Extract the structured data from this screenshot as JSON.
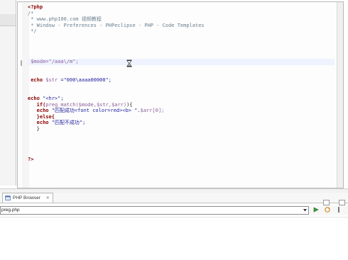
{
  "editor": {
    "lines": [
      {
        "parts": [
          {
            "t": "<?php",
            "c": "kw"
          }
        ]
      },
      {
        "parts": [
          {
            "t": "/*",
            "c": "cm"
          }
        ]
      },
      {
        "parts": [
          {
            "t": " * www.php100.com 视频教程",
            "c": "cm"
          }
        ]
      },
      {
        "parts": [
          {
            "t": " * Window - Preferences - PHPeclipse - PHP - Code Templates",
            "c": "cm"
          }
        ]
      },
      {
        "parts": [
          {
            "t": " */",
            "c": "cm"
          }
        ]
      },
      {
        "parts": []
      },
      {
        "parts": []
      },
      {
        "parts": []
      },
      {
        "parts": []
      },
      {
        "parts": [
          {
            "t": " $mode=\"/aaa\\/m\";",
            "c": "var"
          }
        ],
        "hl": true
      },
      {
        "parts": []
      },
      {
        "parts": []
      },
      {
        "parts": [
          {
            "t": " echo ",
            "c": "kw"
          },
          {
            "t": "$str",
            "c": "var"
          },
          {
            "t": " =\"000\\aaaa00000\";",
            "c": "str"
          }
        ]
      },
      {
        "parts": []
      },
      {
        "parts": []
      },
      {
        "parts": [
          {
            "t": "echo ",
            "c": "kw"
          },
          {
            "t": "\"<hr>\";",
            "c": "str"
          }
        ]
      },
      {
        "parts": [
          {
            "t": "   if(",
            "c": "kw"
          },
          {
            "t": "preg_match($mode,$str,$arr)",
            "c": "var"
          },
          {
            "t": "){",
            "c": ""
          }
        ]
      },
      {
        "parts": [
          {
            "t": "   echo ",
            "c": "kw"
          },
          {
            "t": "\"匹配成功<font color=red><b> \".",
            "c": "str"
          },
          {
            "t": "$arr[0];",
            "c": "var"
          }
        ]
      },
      {
        "parts": [
          {
            "t": "   }else{",
            "c": "kw"
          }
        ]
      },
      {
        "parts": [
          {
            "t": "   echo ",
            "c": "kw"
          },
          {
            "t": "\"匹配不成功\";",
            "c": "str"
          }
        ]
      },
      {
        "parts": [
          {
            "t": "   }",
            "c": ""
          }
        ]
      },
      {
        "parts": []
      },
      {
        "parts": []
      },
      {
        "parts": []
      },
      {
        "parts": []
      },
      {
        "parts": [
          {
            "t": "?>",
            "c": "kw"
          }
        ]
      }
    ]
  },
  "bottom_panel": {
    "tab_label": "PHP Browser",
    "tab_close": "✕",
    "url_value": "preg.php"
  },
  "icons": {
    "hourglass": "hourglass-icon",
    "browser_tab": "globe-icon",
    "dropdown": "chevron-down-icon",
    "go": "go-arrow-icon"
  }
}
